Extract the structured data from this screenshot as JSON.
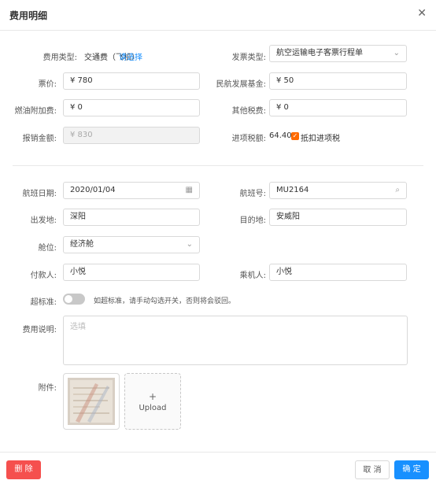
{
  "dialog": {
    "title": "费用明细"
  },
  "form": {
    "expense_type": {
      "label": "费用类型:",
      "value": "交通费（飞机）",
      "link": "请选择"
    },
    "invoice_type": {
      "label": "发票类型:",
      "value": "航空运输电子客票行程单"
    },
    "fare": {
      "label": "票价:",
      "value": "¥ 780"
    },
    "civil_aviation_fund": {
      "label": "民航发展基金:",
      "value": "¥ 50"
    },
    "fuel_surcharge": {
      "label": "燃油附加费:",
      "value": "¥ 0"
    },
    "other_taxes": {
      "label": "其他税费:",
      "value": "¥ 0"
    },
    "reimbursement_amount": {
      "label": "报销金额:",
      "value": "¥ 830"
    },
    "input_tax": {
      "label": "进项税额:",
      "value": "64.40",
      "check_label": "抵扣进项税",
      "checked": true
    },
    "flight_date": {
      "label": "航班日期:",
      "value": "2020/01/04"
    },
    "flight_no": {
      "label": "航班号:",
      "value": "MU2164"
    },
    "departure": {
      "label": "出发地:",
      "value": "深阳"
    },
    "destination": {
      "label": "目的地:",
      "value": "安威阳"
    },
    "cabin": {
      "label": "舱位:",
      "value": "经济舱"
    },
    "payer": {
      "label": "付款人:",
      "value": "小悦"
    },
    "passenger": {
      "label": "乘机人:",
      "value": "小悦"
    },
    "over_standard": {
      "label": "超标准:",
      "on": false,
      "hint": "如超标准，请手动勾选开关，否则将会驳回。"
    },
    "description": {
      "label": "费用说明:",
      "placeholder": "选填"
    },
    "attachment": {
      "label": "附件:",
      "upload_plus": "+",
      "upload_label": "Upload"
    }
  },
  "footer": {
    "delete": "删 除",
    "cancel": "取 消",
    "confirm": "确 定"
  },
  "colors": {
    "primary": "#1890ff",
    "danger": "#f5504e",
    "checkbox": "#ff6a00"
  }
}
